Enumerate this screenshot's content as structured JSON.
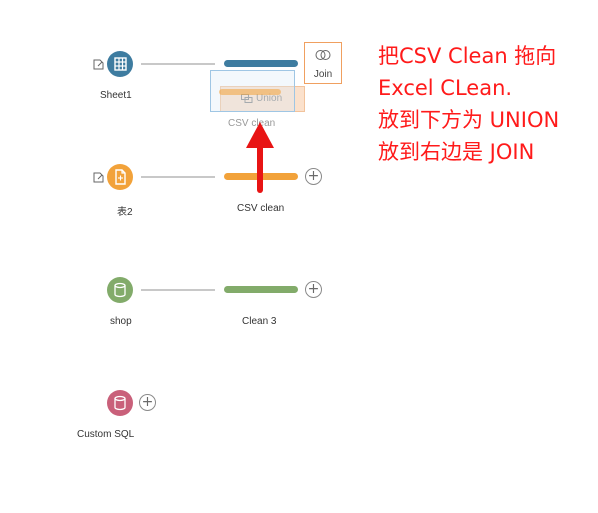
{
  "flow": {
    "nodes": [
      {
        "input_label": "Sheet1",
        "clean_label": "CSV clean",
        "color": "#3e7ca0",
        "icon": "table-icon"
      },
      {
        "input_label": "表2",
        "clean_label": "CSV clean",
        "color": "#f2a23a",
        "icon": "file-icon"
      },
      {
        "input_label": "shop",
        "clean_label": "Clean 3",
        "color": "#82ab6a",
        "icon": "database-icon"
      },
      {
        "input_label": "Custom SQL",
        "color": "#c9607a",
        "icon": "database-icon"
      }
    ],
    "drop_targets": {
      "join_label": "Join",
      "union_label": "Union",
      "join_color": "#f0a060"
    },
    "drag_ghost_label": "CSV clean"
  },
  "annotation": {
    "lines": [
      "把CSV Clean 拖向",
      "Excel CLean.",
      "放到下方为 UNION",
      "放到右边是 JOIN"
    ],
    "color": "#ff1a1a"
  }
}
